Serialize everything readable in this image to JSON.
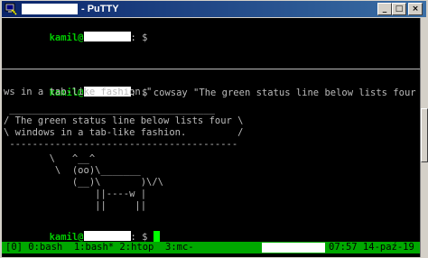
{
  "window": {
    "title": "- PuTTY",
    "buttons": {
      "minimize": "_",
      "maximize": "□",
      "close": "×"
    }
  },
  "terminal": {
    "top_pane": {
      "prompt_user": "kamil@",
      "prompt_suffix": ": $"
    },
    "bottom_pane": {
      "command_prompt_user": "kamil@",
      "command_prompt_suffix": ": $ cowsay \"The green status line below lists four windo",
      "command_wrap": "ws in a tab-like fashion.\"",
      "cowsay_lines": [
        " ____________________________________",
        "/ The green status line below lists four \\",
        "\\ windows in a tab-like fashion.         /",
        " ----------------------------------------",
        "        \\   ^__^",
        "         \\  (oo)\\_______",
        "            (__)\\       )\\/\\",
        "                ||----w |",
        "                ||     ||"
      ],
      "final_prompt_user": "kamil@",
      "final_prompt_suffix": ": $ "
    },
    "status_bar": {
      "windows": "[0] 0:bash  1:bash* 2:htop  3:mc-",
      "clock": "07:57 14-paź-19"
    }
  },
  "colors": {
    "titlebar_start": "#0a246a",
    "titlebar_end": "#3a6ea5",
    "terminal_bg": "#000000",
    "terminal_fg": "#bbbbbb",
    "prompt_green": "#00cd00",
    "status_green": "#00a800",
    "cursor": "#00ff00"
  },
  "icons": {
    "app": "putty-icon"
  }
}
